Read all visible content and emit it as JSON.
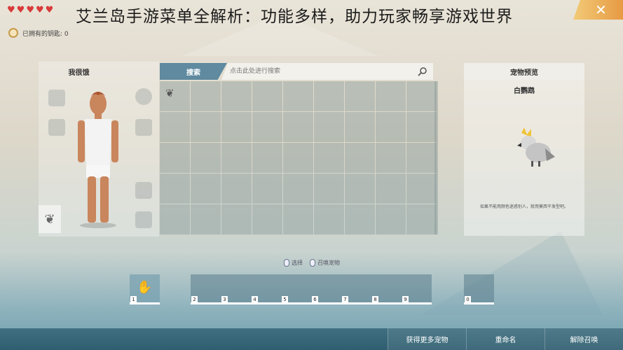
{
  "page_title": "艾兰岛手游菜单全解析：功能多样，助力玩家畅享游戏世界",
  "hearts": [
    "♥",
    "♥",
    "♥",
    "♥",
    "♥"
  ],
  "close_label": "✕",
  "keys": {
    "label": "已拥有的钥匙: 0"
  },
  "character": {
    "name": "我很饿"
  },
  "search": {
    "tab_label": "搜索",
    "placeholder": "点击此处进行搜索"
  },
  "grid": {
    "columns": 9,
    "rows": 5,
    "filled_cells": [
      0
    ]
  },
  "preview": {
    "title": "宠物预览",
    "pet_name": "白鹦鹉",
    "description": "如果不能用颜色迷惑别人，就用莫西干发型吧。"
  },
  "hints": {
    "select_label": "选择",
    "summon_label": "召唤宠物"
  },
  "hotbar": {
    "slots": [
      "1",
      "2",
      "3",
      "4",
      "5",
      "6",
      "7",
      "8",
      "9"
    ],
    "extra_slot": "0"
  },
  "buttons": {
    "get_more_pets": "获得更多宠物",
    "rename": "重命名",
    "dismiss": "解除召唤"
  },
  "colors": {
    "accent": "#5f8aa0",
    "close": "#e79a43",
    "bottom_bar": "#3f6f80",
    "heart": "#d83a3a"
  }
}
